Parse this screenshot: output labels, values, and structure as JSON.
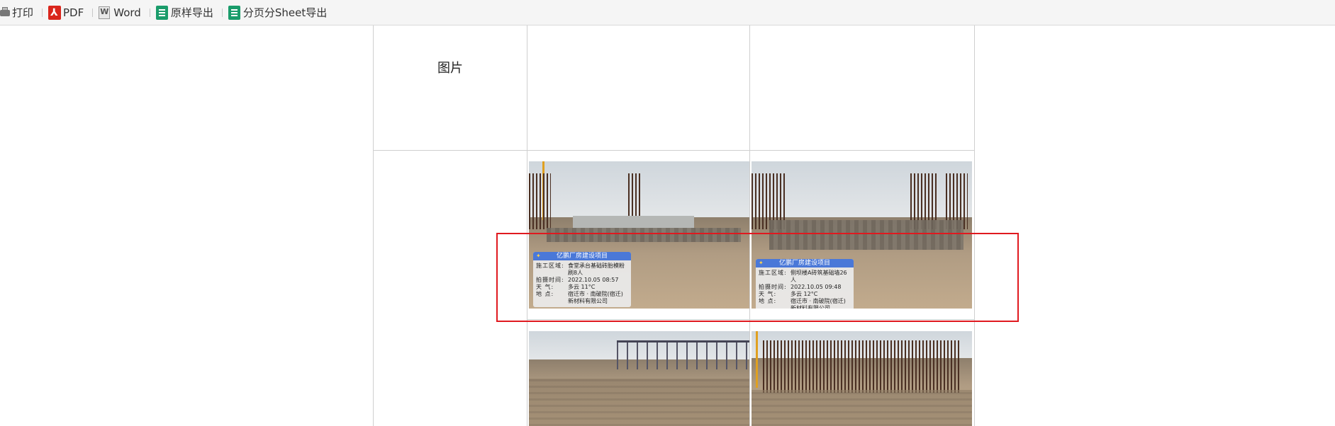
{
  "toolbar": {
    "print_label": "打印",
    "pdf_label": "PDF",
    "word_label": "Word",
    "export_label": "原样导出",
    "sheet_export_label": "分页分Sheet导出"
  },
  "table": {
    "row_label": "图片"
  },
  "photos": [
    {
      "title": "亿鹏厂房建设项目",
      "rows": [
        {
          "key": "施工区域:",
          "val": "食堂承台基础砖胎模粉刷8人"
        },
        {
          "key": "拍摄时间:",
          "val": "2022.10.05 08:57"
        },
        {
          "key": "天 气:",
          "val": "多云 11°C"
        },
        {
          "key": "地 点:",
          "val": "宿迁市 · 南破院(宿迁)新材料有限公司"
        }
      ]
    },
    {
      "title": "亿鹏厂房建设项目",
      "rows": [
        {
          "key": "施工区域:",
          "val": "侧坝楼A砖筑基础墙26人"
        },
        {
          "key": "拍摄时间:",
          "val": "2022.10.05 09:48"
        },
        {
          "key": "天 气:",
          "val": "多云 12°C"
        },
        {
          "key": "地 点:",
          "val": "宿迁市 · 南破院(宿迁)新材料有限公司"
        }
      ]
    }
  ],
  "colors": {
    "highlight": "#e0191f",
    "watermark_header": "#4a78d8"
  }
}
